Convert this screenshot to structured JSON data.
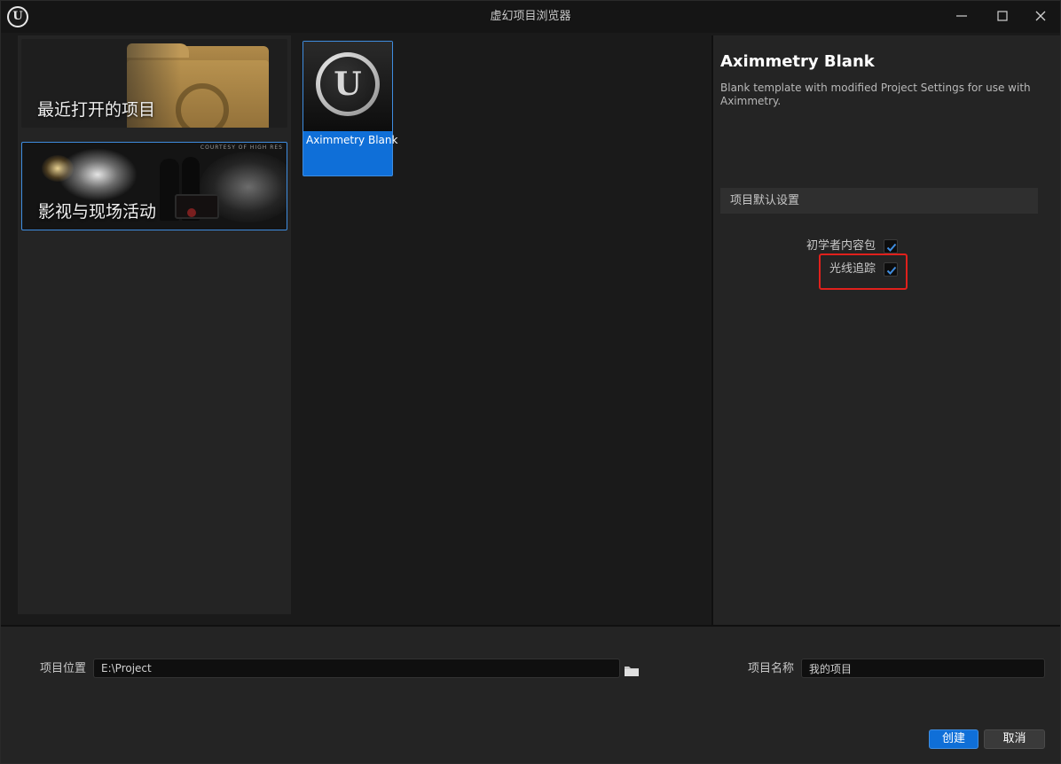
{
  "window": {
    "title": "虚幻项目浏览器",
    "logo_letter": "U"
  },
  "categories": [
    {
      "label": "最近打开的项目",
      "selected": false
    },
    {
      "label": "影视与现场活动",
      "selected": true,
      "image_credit": "COURTESY OF HIGH RES"
    }
  ],
  "templates": [
    {
      "name": "Aximmetry Blank",
      "selected": true,
      "icon": "unreal-engine-logo-icon",
      "logo_letter": "U"
    }
  ],
  "details": {
    "title": "Aximmetry Blank",
    "description": "Blank template with modified Project Settings for use with Aximmetry.",
    "section_title": "项目默认设置",
    "options": [
      {
        "label": "初学者内容包",
        "checked": true
      },
      {
        "label": "光线追踪",
        "checked": true,
        "highlighted": true
      }
    ]
  },
  "footer": {
    "location_label": "项目位置",
    "location_value": "E:\\Project",
    "name_label": "项目名称",
    "name_value": "我的项目",
    "create_label": "创建",
    "cancel_label": "取消"
  },
  "colors": {
    "accent": "#0f6fd8",
    "highlight_box": "#e0201c"
  }
}
